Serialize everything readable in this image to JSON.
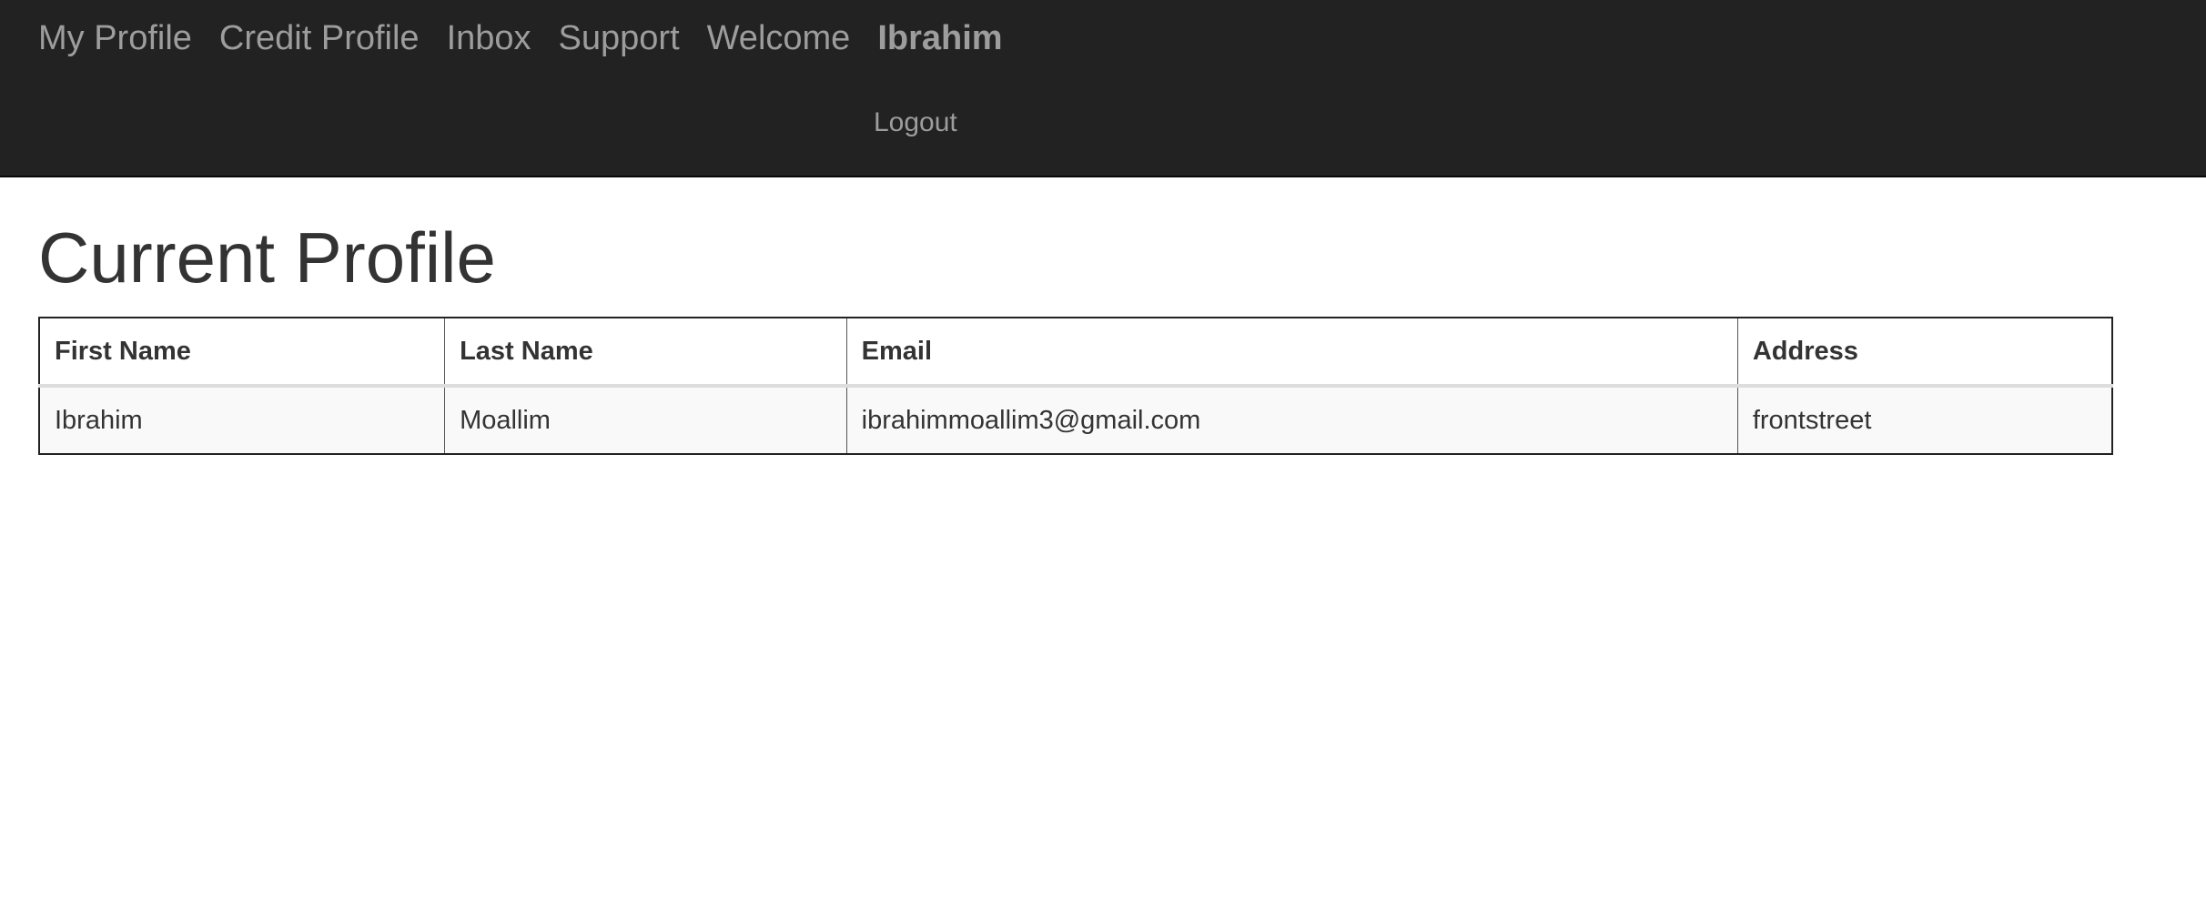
{
  "nav": {
    "items": [
      {
        "label": "My Profile"
      },
      {
        "label": "Credit Profile"
      },
      {
        "label": "Inbox"
      },
      {
        "label": "Support"
      }
    ],
    "welcome": "Welcome",
    "user": "Ibrahim",
    "logout": "Logout"
  },
  "page": {
    "title": "Current Profile"
  },
  "table": {
    "headers": [
      "First Name",
      "Last Name",
      "Email",
      "Address"
    ],
    "rows": [
      [
        "Ibrahim",
        "Moallim",
        "ibrahimmoallim3@gmail.com",
        "frontstreet"
      ]
    ]
  },
  "colors": {
    "navbar_bg": "#222222",
    "nav_text": "#9d9d9d",
    "body_text": "#333333"
  }
}
